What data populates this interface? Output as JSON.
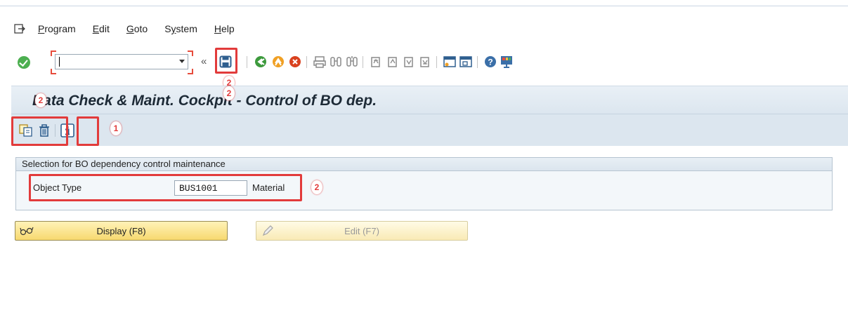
{
  "menu": {
    "items": [
      {
        "accel": "P",
        "rest": "rogram"
      },
      {
        "accel": "E",
        "rest": "dit"
      },
      {
        "accel": "G",
        "rest": "oto"
      },
      {
        "accel": "",
        "pre": "S",
        "accelMid": "y",
        "rest": "stem"
      },
      {
        "accel": "H",
        "rest": "elp"
      }
    ]
  },
  "toolbar": {
    "command_value": "",
    "collapse_glyph": "«"
  },
  "title": "Data Check & Maint. Cockpit - Control of BO dep.",
  "frame": {
    "header": "Selection for BO dependency control maintenance",
    "object_type_label": "Object Type",
    "object_type_value": "BUS1001",
    "object_type_desc": "Material"
  },
  "buttons": {
    "display": "Display (F8)",
    "edit": "Edit (F7)"
  },
  "callouts": {
    "save": "2",
    "title_left": "2",
    "title_mid": "2",
    "info": "1",
    "frame": "2"
  },
  "colors": {
    "highlight": "#e23b3b",
    "title_band": "#dce6ef",
    "button_yellow": "#f7d96f"
  }
}
